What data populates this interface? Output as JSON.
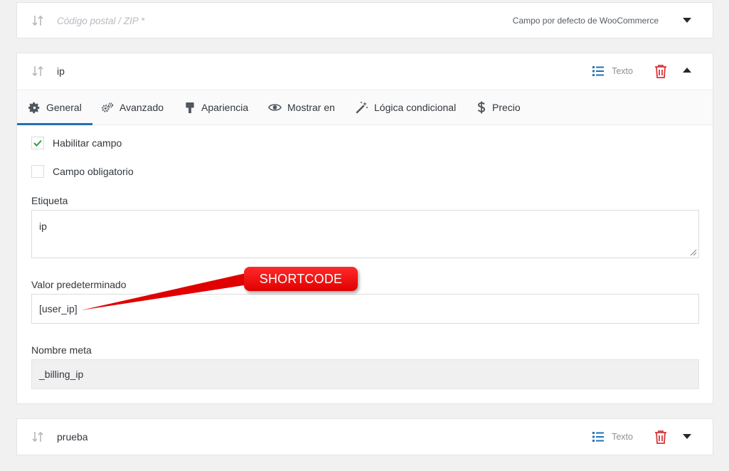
{
  "fields": [
    {
      "title": "Código postal / ZIP *",
      "info": "Campo por defecto de WooCommerce"
    },
    {
      "title": "ip",
      "type_label": "Texto"
    },
    {
      "title": "prueba",
      "type_label": "Texto"
    }
  ],
  "tabs": [
    {
      "label": "General",
      "icon": "gear-icon"
    },
    {
      "label": "Avanzado",
      "icon": "gears-icon"
    },
    {
      "label": "Apariencia",
      "icon": "paint-roller-icon"
    },
    {
      "label": "Mostrar en",
      "icon": "eye-icon"
    },
    {
      "label": "Lógica condicional",
      "icon": "magic-wand-icon"
    },
    {
      "label": "Precio",
      "icon": "dollar-icon"
    }
  ],
  "form": {
    "enable_label": "Habilitar campo",
    "enable_checked": true,
    "required_label": "Campo obligatorio",
    "required_checked": false,
    "etiqueta_label": "Etiqueta",
    "etiqueta_value": "ip",
    "default_label": "Valor predeterminado",
    "default_value": "[user_ip]",
    "meta_label": "Nombre meta",
    "meta_value": "_billing_ip"
  },
  "annotation": {
    "text": "SHORTCODE"
  },
  "colors": {
    "accent": "#2271b1",
    "danger": "#d63638",
    "annotation": "#ff0000",
    "check": "#2ea043"
  }
}
